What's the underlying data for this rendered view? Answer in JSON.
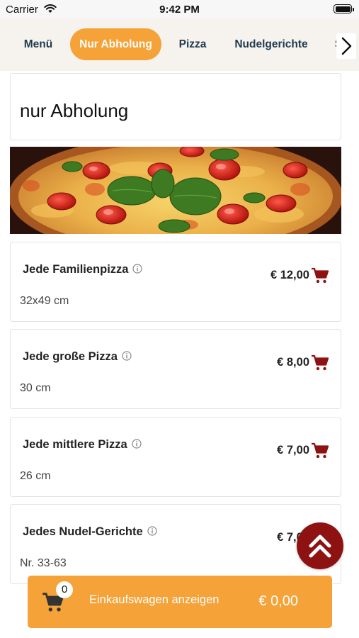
{
  "status_bar": {
    "carrier": "Carrier",
    "time": "9:42 PM"
  },
  "tabs": [
    {
      "label": "Menü",
      "active": false
    },
    {
      "label": "Nur Abholung",
      "active": true
    },
    {
      "label": "Pizza",
      "active": false
    },
    {
      "label": "Nudelgerichte",
      "active": false
    },
    {
      "label": "S",
      "active": false
    }
  ],
  "section": {
    "title": "nur Abholung"
  },
  "items": [
    {
      "name": "Jede Familienpizza",
      "description": "32x49 cm",
      "price": "€ 12,00"
    },
    {
      "name": "Jede große Pizza",
      "description": "30 cm",
      "price": "€ 8,00"
    },
    {
      "name": "Jede mittlere Pizza",
      "description": "26 cm",
      "price": "€ 7,00"
    },
    {
      "name": "Jedes Nudel-Gerichte",
      "description": "Nr. 33-63",
      "price": "€ 7,00"
    }
  ],
  "cart": {
    "count": "0",
    "label": "Einkaufswagen anzeigen",
    "total": "€ 0,00"
  },
  "colors": {
    "accent": "#f5a238",
    "cart_icon": "#8e1212",
    "nav_text": "#1f3b4d"
  },
  "icons": [
    "wifi-icon",
    "battery-icon",
    "chevron-right-icon",
    "info-icon",
    "cart-icon",
    "double-chevron-up-icon"
  ]
}
